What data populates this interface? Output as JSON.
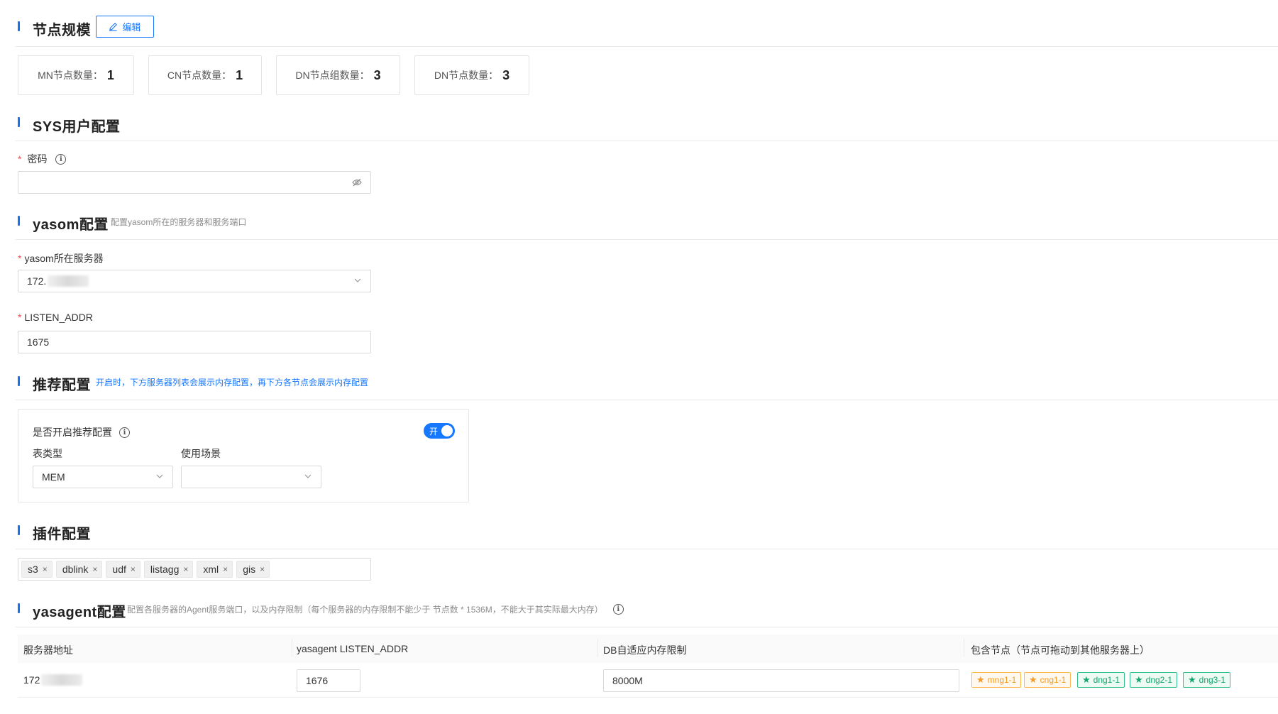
{
  "node_scale": {
    "title": "节点规模",
    "edit_label": "编辑",
    "stats": [
      {
        "label": "MN节点数量：",
        "value": "1"
      },
      {
        "label": "CN节点数量：",
        "value": "1"
      },
      {
        "label": "DN节点组数量：",
        "value": "3"
      },
      {
        "label": "DN节点数量：",
        "value": "3"
      }
    ]
  },
  "sys_user": {
    "title": "SYS用户配置",
    "password_label": "密码",
    "password_value": "",
    "required_mark": "*"
  },
  "yasom": {
    "title": "yasom配置",
    "subtitle": "配置yasom所在的服务器和服务端口",
    "server_label": "yasom所在服务器",
    "server_value": "172.",
    "listen_label": "LISTEN_ADDR",
    "listen_value": "1675"
  },
  "recommend": {
    "title": "推荐配置",
    "subtitle": "开启时，下方服务器列表会展示内存配置，再下方各节点会展示内存配置",
    "enable_label": "是否开启推荐配置",
    "switch_text": "开",
    "table_type_label": "表类型",
    "table_type_value": "MEM",
    "scenario_label": "使用场景",
    "scenario_value": ""
  },
  "plugins": {
    "title": "插件配置",
    "tags": [
      "s3",
      "dblink",
      "udf",
      "listagg",
      "xml",
      "gis"
    ],
    "remove_glyph": "×"
  },
  "yasagent": {
    "title": "yasagent配置",
    "subtitle": "配置各服务器的Agent服务端口，以及内存限制（每个服务器的内存限制不能少于 节点数 * 1536M，不能大于其实际最大内存）",
    "columns": [
      "服务器地址",
      "yasagent LISTEN_ADDR",
      "DB自适应内存限制",
      "包含节点（节点可拖动到其他服务器上）"
    ],
    "rows": [
      {
        "server": "172",
        "listen": "1676",
        "memory": "8000M",
        "nodes": [
          {
            "name": "mng1-1",
            "color": "orange"
          },
          {
            "name": "cng1-1",
            "color": "orange"
          },
          {
            "name": "dng1-1",
            "color": "green"
          },
          {
            "name": "dng2-1",
            "color": "green"
          },
          {
            "name": "dng3-1",
            "color": "green"
          }
        ]
      }
    ]
  },
  "colors": {
    "accent": "#1677ff",
    "required": "#ff4d4f",
    "node_orange": "#f59a23",
    "node_green": "#12a56c"
  }
}
